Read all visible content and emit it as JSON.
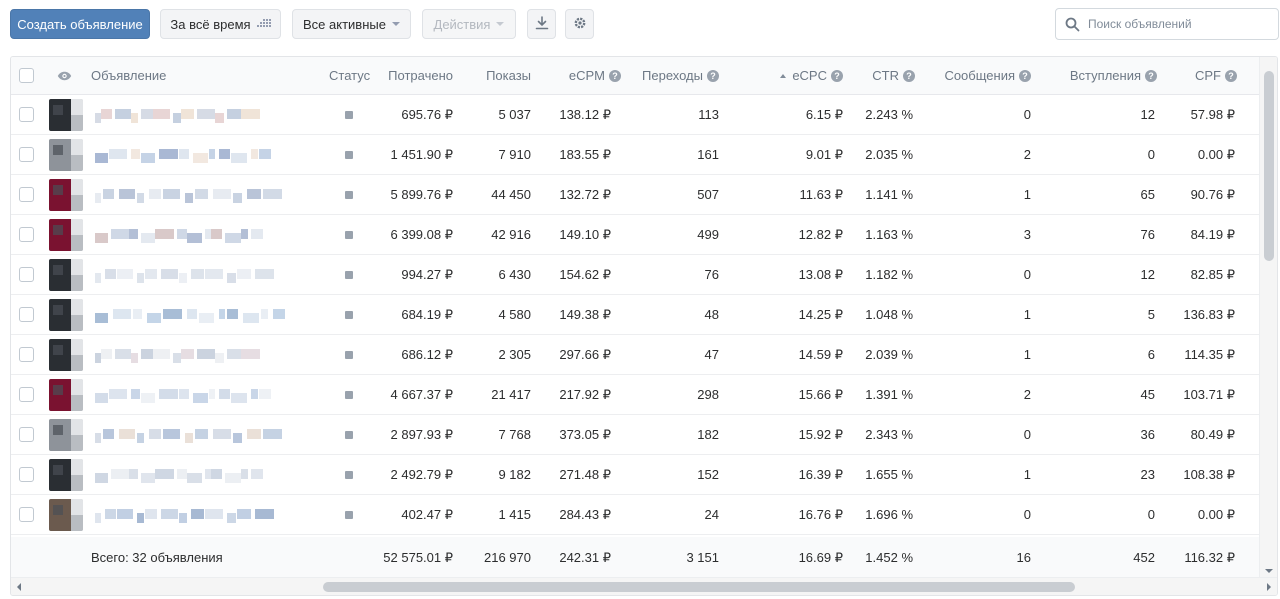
{
  "toolbar": {
    "create_label": "Создать объявление",
    "period_label": "За всё время",
    "filter_label": "Все активные",
    "actions_label": "Действия",
    "search_placeholder": "Поиск объявлений"
  },
  "table": {
    "headers": {
      "ad": "Объявление",
      "status": "Статус",
      "spent": "Потрачено",
      "impressions": "Показы",
      "ecpm": "eCPM",
      "clicks": "Переходы",
      "ecpc": "eCPC",
      "ctr": "CTR",
      "messages": "Сообщения",
      "joins": "Вступления",
      "cpf": "CPF"
    },
    "rows": [
      {
        "spent": "695.76 ₽",
        "impressions": "5 037",
        "ecpm": "138.12 ₽",
        "clicks": "113",
        "ecpc": "6.15 ₽",
        "ctr": "2.243 %",
        "messages": "0",
        "joins": "12",
        "cpf": "57.98 ₽"
      },
      {
        "spent": "1 451.90 ₽",
        "impressions": "7 910",
        "ecpm": "183.55 ₽",
        "clicks": "161",
        "ecpc": "9.01 ₽",
        "ctr": "2.035 %",
        "messages": "2",
        "joins": "0",
        "cpf": "0.00 ₽"
      },
      {
        "spent": "5 899.76 ₽",
        "impressions": "44 450",
        "ecpm": "132.72 ₽",
        "clicks": "507",
        "ecpc": "11.63 ₽",
        "ctr": "1.141 %",
        "messages": "1",
        "joins": "65",
        "cpf": "90.76 ₽"
      },
      {
        "spent": "6 399.08 ₽",
        "impressions": "42 916",
        "ecpm": "149.10 ₽",
        "clicks": "499",
        "ecpc": "12.82 ₽",
        "ctr": "1.163 %",
        "messages": "3",
        "joins": "76",
        "cpf": "84.19 ₽"
      },
      {
        "spent": "994.27 ₽",
        "impressions": "6 430",
        "ecpm": "154.62 ₽",
        "clicks": "76",
        "ecpc": "13.08 ₽",
        "ctr": "1.182 %",
        "messages": "0",
        "joins": "12",
        "cpf": "82.85 ₽"
      },
      {
        "spent": "684.19 ₽",
        "impressions": "4 580",
        "ecpm": "149.38 ₽",
        "clicks": "48",
        "ecpc": "14.25 ₽",
        "ctr": "1.048 %",
        "messages": "1",
        "joins": "5",
        "cpf": "136.83 ₽"
      },
      {
        "spent": "686.12 ₽",
        "impressions": "2 305",
        "ecpm": "297.66 ₽",
        "clicks": "47",
        "ecpc": "14.59 ₽",
        "ctr": "2.039 %",
        "messages": "1",
        "joins": "6",
        "cpf": "114.35 ₽"
      },
      {
        "spent": "4 667.37 ₽",
        "impressions": "21 417",
        "ecpm": "217.92 ₽",
        "clicks": "298",
        "ecpc": "15.66 ₽",
        "ctr": "1.391 %",
        "messages": "2",
        "joins": "45",
        "cpf": "103.71 ₽"
      },
      {
        "spent": "2 897.93 ₽",
        "impressions": "7 768",
        "ecpm": "373.05 ₽",
        "clicks": "182",
        "ecpc": "15.92 ₽",
        "ctr": "2.343 %",
        "messages": "0",
        "joins": "36",
        "cpf": "80.49 ₽"
      },
      {
        "spent": "2 492.79 ₽",
        "impressions": "9 182",
        "ecpm": "271.48 ₽",
        "clicks": "152",
        "ecpc": "16.39 ₽",
        "ctr": "1.655 %",
        "messages": "1",
        "joins": "23",
        "cpf": "108.38 ₽"
      },
      {
        "spent": "402.47 ₽",
        "impressions": "1 415",
        "ecpm": "284.43 ₽",
        "clicks": "24",
        "ecpc": "16.76 ₽",
        "ctr": "1.696 %",
        "messages": "0",
        "joins": "0",
        "cpf": "0.00 ₽"
      }
    ],
    "total": {
      "label": "Всего: 32 объявления",
      "spent": "52 575.01 ₽",
      "impressions": "216 970",
      "ecpm": "242.31 ₽",
      "clicks": "3 151",
      "ecpc": "16.69 ₽",
      "ctr": "1.452 %",
      "messages": "16",
      "joins": "452",
      "cpf": "116.32 ₽"
    }
  },
  "colors": {
    "primary": "#5181b8",
    "status": "#99a2ad",
    "thumb_dark": "#2a2e33",
    "thumb_red": "#7a1230"
  },
  "icons": {
    "search": "search-icon",
    "download": "download-icon",
    "settings": "gear-icon",
    "eye": "eye-icon",
    "help": "help-icon",
    "sort": "sort-up-icon",
    "grid": "grid-icon"
  }
}
